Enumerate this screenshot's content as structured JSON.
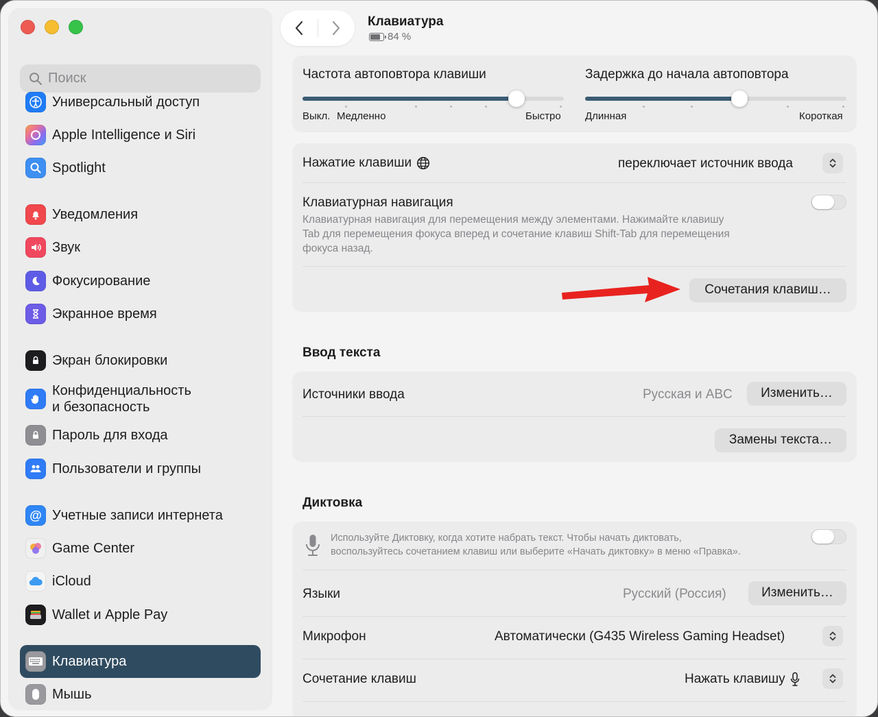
{
  "window": {
    "title": "Клавиатура",
    "battery": "84 %"
  },
  "sidebar": {
    "search_placeholder": "Поиск",
    "items": [
      {
        "label": "Универсальный доступ",
        "icon": "accessibility-icon",
        "color": "#1f7cf6"
      },
      {
        "label": "Apple Intelligence и Siri",
        "icon": "apple-intelligence-icon",
        "color": "#e8719a"
      },
      {
        "label": "Spotlight",
        "icon": "spotlight-icon",
        "color": "#3e8ff2"
      },
      {
        "label": "Уведомления",
        "icon": "notifications-icon",
        "color": "#f0484c"
      },
      {
        "label": "Звук",
        "icon": "sound-icon",
        "color": "#f0485e"
      },
      {
        "label": "Фокусирование",
        "icon": "focus-icon",
        "color": "#5e5ce6"
      },
      {
        "label": "Экранное время",
        "icon": "screen-time-icon",
        "color": "#6d5ce6"
      },
      {
        "label": "Экран блокировки",
        "icon": "lock-screen-icon",
        "color": "#1d1d1f"
      },
      {
        "label": "Конфиденциальность",
        "label2": "и безопасность",
        "icon": "privacy-hand-icon",
        "color": "#2f7cf6"
      },
      {
        "label": "Пароль для входа",
        "icon": "password-lock-icon",
        "color": "#8e8e93"
      },
      {
        "label": "Пользователи и группы",
        "icon": "users-icon",
        "color": "#2f7cf6"
      },
      {
        "label": "Учетные записи интернета",
        "icon": "internet-accounts-icon",
        "color": "#2f86f6"
      },
      {
        "label": "Game Center",
        "icon": "game-center-icon",
        "color": "#f0f0f0"
      },
      {
        "label": "iCloud",
        "icon": "icloud-icon",
        "color": "#f4f4f4"
      },
      {
        "label": "Wallet и Apple Pay",
        "icon": "wallet-icon",
        "color": "#1d1d1f"
      },
      {
        "label": "Клавиатура",
        "icon": "keyboard-icon",
        "color": "#9a9a9e",
        "selected": true
      },
      {
        "label": "Мышь",
        "icon": "mouse-icon",
        "color": "#9a9a9e"
      }
    ]
  },
  "repeat": {
    "rate_label": "Частота автоповтора клавиши",
    "rate_off": "Выкл.",
    "rate_slow": "Медленно",
    "rate_fast": "Быстро",
    "rate_value": 0.82,
    "delay_label": "Задержка до начала автоповтора",
    "delay_long": "Длинная",
    "delay_short": "Короткая",
    "delay_value": 0.59
  },
  "keys": {
    "press_label": "Нажатие клавиши",
    "press_value": "переключает источник ввода",
    "nav_label": "Клавиатурная навигация",
    "nav_desc_1": "Клавиатурная навигация для перемещения между элементами. Нажимайте клавишу",
    "nav_desc_2": "Tab для перемещения фокуса вперед и сочетание клавиш Shift-Tab для перемещения",
    "nav_desc_3": "фокуса назад.",
    "shortcuts_button": "Сочетания клавиш…"
  },
  "text_input": {
    "heading": "Ввод текста",
    "sources_label": "Источники ввода",
    "sources_value": "Русская и ABC",
    "edit_button": "Изменить…",
    "replacements_button": "Замены текста…"
  },
  "dictation": {
    "heading": "Диктовка",
    "desc_1": "Используйте Диктовку, когда хотите набрать текст. Чтобы начать диктовать,",
    "desc_2": "воспользуйтесь сочетанием клавиш или выберите «Начать диктовку» в меню «Правка».",
    "languages_label": "Языки",
    "languages_value": "Русский (Россия)",
    "edit_button": "Изменить…",
    "mic_label": "Микрофон",
    "mic_value": "Автоматически (G435 Wireless Gaming Headset)",
    "shortcut_label": "Сочетание клавиш",
    "shortcut_value": "Нажать клавишу"
  },
  "colors": {
    "accent": "#3b5b73",
    "selection": "#2f4b60",
    "arrow": "#e8231f"
  }
}
